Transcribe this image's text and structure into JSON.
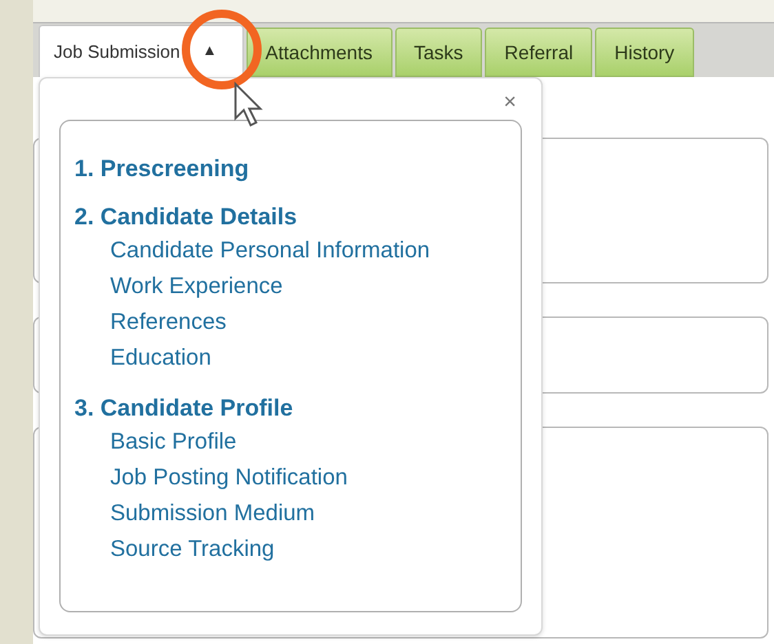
{
  "tabs": [
    {
      "label": "Job Submission",
      "caret": "▲",
      "selected": true
    },
    {
      "label": "Attachments",
      "selected": false
    },
    {
      "label": "Tasks",
      "selected": false
    },
    {
      "label": "Referral",
      "selected": false
    },
    {
      "label": "History",
      "selected": false
    }
  ],
  "menu": {
    "close": "×",
    "sections": [
      {
        "title": "1. Prescreening"
      },
      {
        "title": "2. Candidate Details",
        "items": [
          "Candidate Personal Information",
          "Work Experience",
          "References",
          "Education"
        ]
      },
      {
        "title": "3. Candidate Profile",
        "items": [
          "Basic Profile",
          "Job Posting Notification",
          "Submission Medium",
          "Source Tracking"
        ]
      }
    ]
  }
}
